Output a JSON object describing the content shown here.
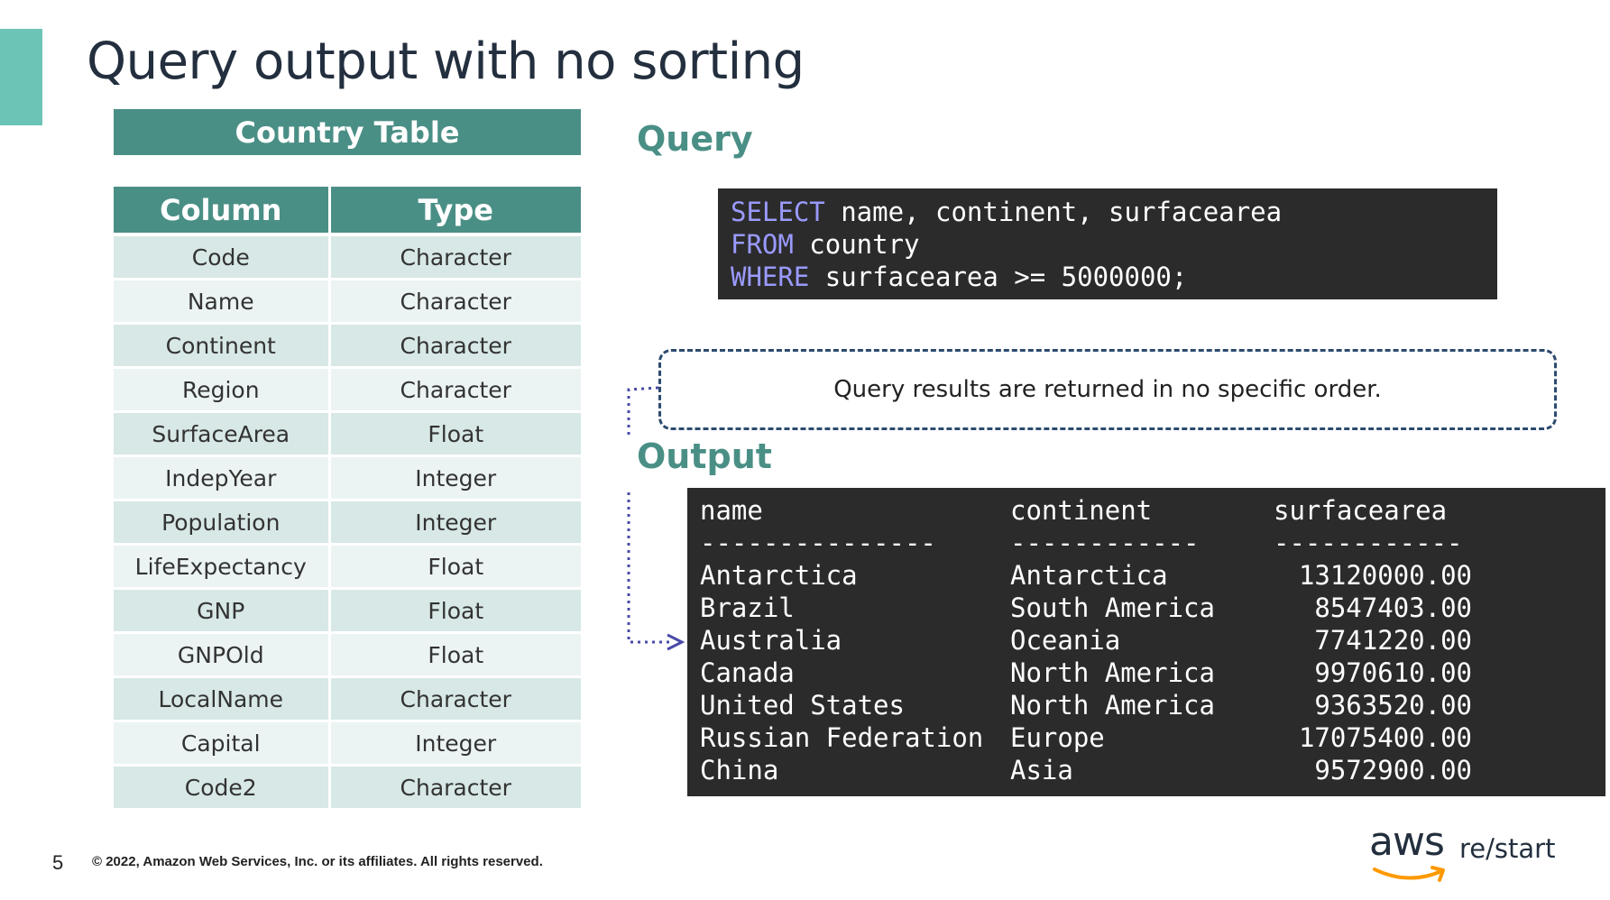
{
  "slide": {
    "title": "Query output with no sorting",
    "page_number": "5",
    "copyright": "© 2022, Amazon Web Services, Inc. or its affiliates. All rights reserved."
  },
  "country_table": {
    "title": "Country Table",
    "headers": [
      "Column",
      "Type"
    ],
    "rows": [
      [
        "Code",
        "Character"
      ],
      [
        "Name",
        "Character"
      ],
      [
        "Continent",
        "Character"
      ],
      [
        "Region",
        "Character"
      ],
      [
        "SurfaceArea",
        "Float"
      ],
      [
        "IndepYear",
        "Integer"
      ],
      [
        "Population",
        "Integer"
      ],
      [
        "LifeExpectancy",
        "Float"
      ],
      [
        "GNP",
        "Float"
      ],
      [
        "GNPOld",
        "Float"
      ],
      [
        "LocalName",
        "Character"
      ],
      [
        "Capital",
        "Integer"
      ],
      [
        "Code2",
        "Character"
      ]
    ]
  },
  "query": {
    "label": "Query",
    "lines": [
      {
        "keyword": "SELECT",
        "rest": " name, continent, surfacearea"
      },
      {
        "keyword": "FROM",
        "rest": " country"
      },
      {
        "keyword": "WHERE",
        "rest": " surfacearea >= 5000000;"
      }
    ]
  },
  "note": "Query results are returned in no specific order.",
  "output": {
    "label": "Output",
    "headers": [
      "name",
      "continent",
      "surfacearea"
    ],
    "separators": [
      "---------------",
      "------------",
      "------------"
    ],
    "rows": [
      [
        "Antarctica",
        "Antarctica",
        "13120000.00"
      ],
      [
        "Brazil",
        "South America",
        "8547403.00"
      ],
      [
        "Australia",
        "Oceania",
        "7741220.00"
      ],
      [
        "Canada",
        "North America",
        "9970610.00"
      ],
      [
        "United States",
        "North America",
        "9363520.00"
      ],
      [
        "Russian Federation",
        "Europe",
        "17075400.00"
      ],
      [
        "China",
        "Asia",
        "9572900.00"
      ]
    ]
  },
  "logo": {
    "brand": "aws",
    "product": "re/start"
  },
  "colors": {
    "accent": "#6cc4b6",
    "teal": "#4a8f86",
    "keyword": "#9a9aff",
    "code_bg": "#2b2b2b",
    "logo_smile": "#ff9900"
  }
}
